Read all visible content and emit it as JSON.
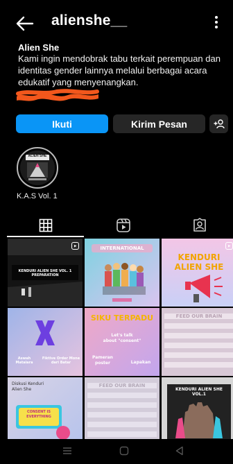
{
  "header": {
    "username": "alienshe__"
  },
  "profile": {
    "name": "Alien She",
    "bio": "Kami ingin mendobrak tabu terkait perempuan dan identitas gender lainnya melalui berbagai acara edukatif yang menyenangkan."
  },
  "actions": {
    "follow_label": "Ikuti",
    "message_label": "Kirim Pesan"
  },
  "highlight": {
    "label": "K.A.S Vol. 1",
    "cover_text": "ALIEN SHE"
  },
  "tabs": [
    {
      "icon": "grid-icon"
    },
    {
      "icon": "reels-icon"
    },
    {
      "icon": "tagged-icon"
    }
  ],
  "posts": [
    {
      "id": 1,
      "text": "KENDURI ALIEN SHE VOL. 1\nPREPARATION"
    },
    {
      "id": 2,
      "text": "INTERNATIONAL"
    },
    {
      "id": 3,
      "text": "KENDURI\nALIEN SHE"
    },
    {
      "id": 4,
      "text1": "Aswah Mataiara",
      "text2": "Fiktive Order Mone dari Batar"
    },
    {
      "id": 5,
      "text": "SIKU TERPADU",
      "sub1": "Let's talk\nabout \"consent\"",
      "sub2": "Pameran\nposter",
      "sub3": "Lapakan"
    },
    {
      "id": 6,
      "text": "FEED OUR BRAIN"
    },
    {
      "id": 7,
      "text": "Diskusi Kenduri\nAlien She",
      "badge": "CONSENT IS\nEVERYTHING"
    },
    {
      "id": 8,
      "text": "FEED OUR BRAIN"
    },
    {
      "id": 9,
      "text": "KENDURI ALIEN SHE VOL.1"
    }
  ],
  "colors": {
    "follow": "#0a95f6",
    "button_dark": "#262626",
    "redaction": "#f2571c"
  }
}
